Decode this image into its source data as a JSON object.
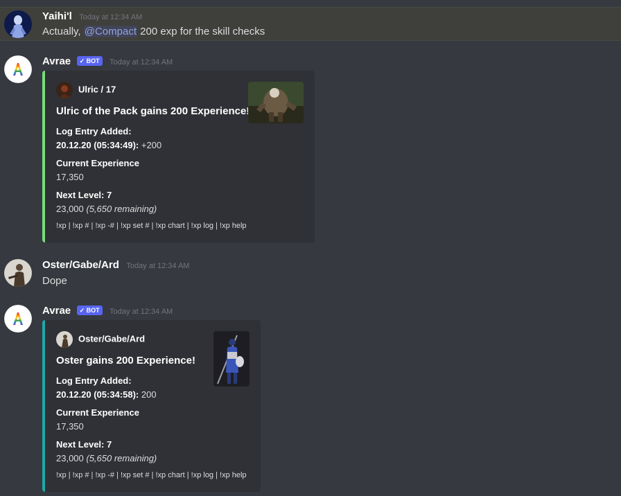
{
  "messages": [
    {
      "username": "Yaihi'l",
      "timestamp": "Today at 12:34 AM",
      "text_before": "Actually, ",
      "mention": "@Compact",
      "text_after": " 200 exp for the skill checks"
    },
    {
      "username": "Avrae",
      "bot_tag": "✓ BOT",
      "timestamp": "Today at 12:34 AM",
      "embed": {
        "author": "Ulric / 17",
        "title": "Ulric of the Pack gains 200 Experience!",
        "log_label": "Log Entry Added:",
        "log_date": "20.12.20 (05:34:49):",
        "log_value": " +200",
        "current_label": "Current Experience",
        "current_value": "17,350",
        "next_label": "Next Level: 7",
        "next_value": "23,000 ",
        "next_remaining": "(5,650 remaining)",
        "footer": "!xp | !xp # | !xp -# | !xp set # | !xp chart | !xp log | !xp help"
      }
    },
    {
      "username": "Oster/Gabe/Ard",
      "timestamp": "Today at 12:34 AM",
      "text": "Dope"
    },
    {
      "username": "Avrae",
      "bot_tag": "✓ BOT",
      "timestamp": "Today at 12:34 AM",
      "embed": {
        "author": "Oster/Gabe/Ard",
        "title": "Oster gains 200 Experience!",
        "log_label": "Log Entry Added:",
        "log_date": "20.12.20 (05:34:58):",
        "log_value": " 200",
        "current_label": "Current Experience",
        "current_value": "17,350",
        "next_label": "Next Level: 7",
        "next_value": "23,000 ",
        "next_remaining": "(5,650 remaining)",
        "footer": "!xp | !xp # | !xp -# | !xp set # | !xp chart | !xp log | !xp help"
      }
    }
  ],
  "colors": {
    "background": "#36393f",
    "embed_bg": "#2f3136",
    "embed1_accent": "#77dd77",
    "embed2_accent": "#1fa8a8",
    "mention": "#8ea1e1",
    "bot_badge": "#5865f2"
  },
  "icons": {
    "yaihil_avatar": "ghost-figure-avatar",
    "avrae_avatar": "rainbow-a-logo-avatar",
    "oster_avatar": "armored-warrior-avatar",
    "ulric_thumbnail": "beast-warrior-thumbnail",
    "oster_thumbnail": "knight-with-spear-thumbnail"
  }
}
